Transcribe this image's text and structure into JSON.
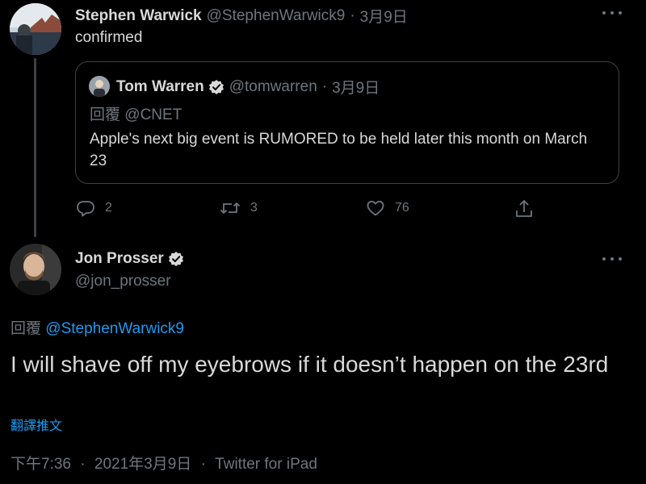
{
  "parent_tweet": {
    "author_name": "Stephen Warwick",
    "handle": "@StephenWarwick9",
    "separator": "·",
    "date": "3月9日",
    "text": "confirmed"
  },
  "quoted_tweet": {
    "author_name": "Tom Warren",
    "handle": "@tomwarren",
    "separator": "·",
    "date": "3月9日",
    "reply_prefix": "回覆",
    "reply_to": "@CNET",
    "text": "Apple's next big event is RUMORED to be held later this month on March 23"
  },
  "actions": {
    "replies": "2",
    "retweets": "3",
    "likes": "76"
  },
  "main_tweet": {
    "author_name": "Jon Prosser",
    "handle": "@jon_prosser",
    "reply_prefix": "回覆",
    "reply_to": "@StephenWarwick9",
    "text": "I will shave off my eyebrows if it doesn’t happen on the 23rd",
    "translate_label": "翻譯推文",
    "time": "下午7:36",
    "separator": "·",
    "date": "2021年3月9日",
    "source": "Twitter for iPad"
  },
  "icons": {
    "more": "more-horizontal-icon",
    "verified": "verified-badge-icon",
    "reply": "reply-icon",
    "retweet": "retweet-icon",
    "like": "heart-icon",
    "share": "share-icon"
  },
  "colors": {
    "background": "#000000",
    "text_primary": "#d9d9d9",
    "text_secondary": "#6e767d",
    "link": "#1d9bf0",
    "border": "#3d4144"
  }
}
